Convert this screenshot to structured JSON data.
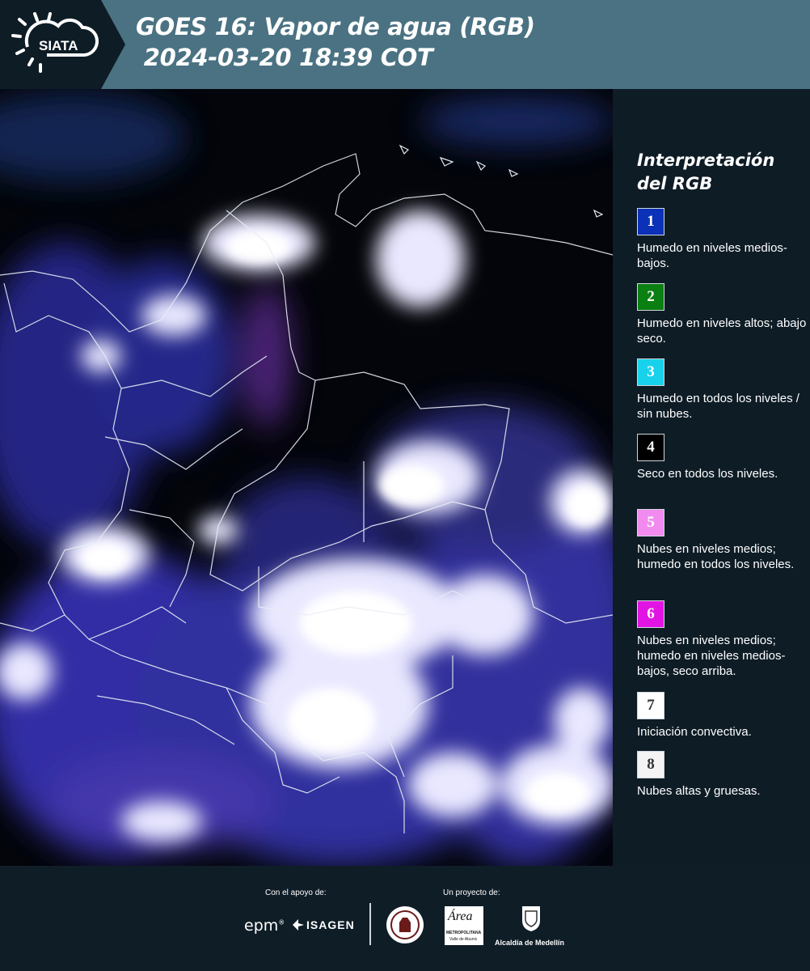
{
  "header": {
    "logo_text": "SIATA",
    "title_line1": "GOES 16: Vapor de agua (RGB)",
    "title_line2": " 2024-03-20 18:39 COT",
    "background_color": "#4a7282"
  },
  "map": {
    "description_icon": "satellite-water-vapor-rgb-composite"
  },
  "legend": {
    "title_line1": "Interpretación",
    "title_line2": "del RGB",
    "items": [
      {
        "number": "1",
        "color": "#0b31b8",
        "text_color": "#ffffff",
        "description": "Humedo en niveles medios-bajos."
      },
      {
        "number": "2",
        "color": "#0a7f12",
        "text_color": "#ffffff",
        "description": "Humedo en niveles altos; abajo seco."
      },
      {
        "number": "3",
        "color": "#17d2ea",
        "text_color": "#ffffff",
        "description": "Humedo en todos los niveles / sin nubes."
      },
      {
        "number": "4",
        "color": "#000000",
        "text_color": "#ffffff",
        "description": "Seco en todos los niveles."
      },
      {
        "number": "5",
        "color": "#f28bf0",
        "text_color": "#ffffff",
        "description": "Nubes en niveles medios; humedo en todos los niveles."
      },
      {
        "number": "6",
        "color": "#e214e3",
        "text_color": "#ffffff",
        "description": "Nubes en niveles medios; humedo en niveles medios-bajos, seco arriba."
      },
      {
        "number": "7",
        "color": "#ffffff",
        "text_color": "#333333",
        "description": "Iniciación convectiva."
      },
      {
        "number": "8",
        "color": "#f4f4f4",
        "text_color": "#333333",
        "description": "Nubes altas y gruesas."
      }
    ]
  },
  "footer": {
    "support_label": "Con el apoyo de:",
    "project_label": "Un proyecto de:",
    "sponsor_epm": "epm",
    "sponsor_isagen": "ISAGEN",
    "area_logo_text": "Área",
    "area_subtext": "METROPOLITANA",
    "area_subtext2": "Valle de Aburrá",
    "alcaldia": "Alcaldía de Medellín"
  }
}
